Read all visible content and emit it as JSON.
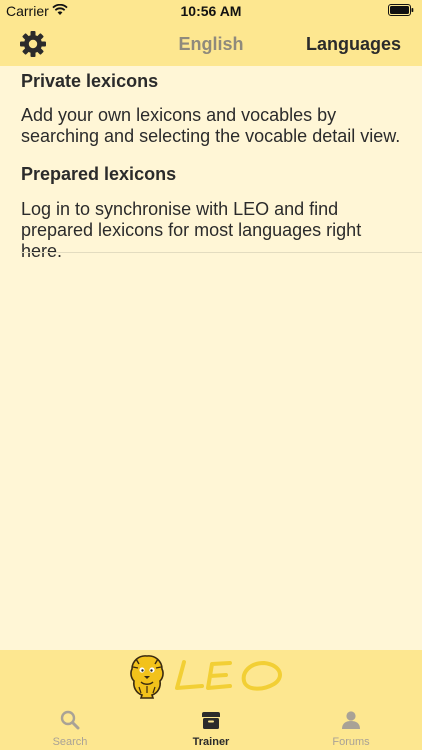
{
  "status": {
    "carrier": "Carrier",
    "time": "10:56 AM"
  },
  "nav": {
    "title": "English",
    "languages_label": "Languages"
  },
  "sections": [
    {
      "header": "Private lexicons",
      "text": "Add your own lexicons and vocables by searching and selecting the vocable detail view."
    },
    {
      "header": "Prepared lexicons",
      "text": "Log in to synchronise with LEO and find prepared lexicons for most languages right here."
    }
  ],
  "logo": {
    "text": "LEO",
    "icon": "lion-mascot-icon"
  },
  "tabs": [
    {
      "label": "Search",
      "icon": "magnifier-icon",
      "active": false
    },
    {
      "label": "Trainer",
      "icon": "box-icon",
      "active": true
    },
    {
      "label": "Forums",
      "icon": "person-icon",
      "active": false
    }
  ],
  "colors": {
    "bar_background": "#fde790",
    "content_background": "#fff6d6",
    "inactive_tab": "#a9a296",
    "active_tab": "#2b2b2b"
  }
}
